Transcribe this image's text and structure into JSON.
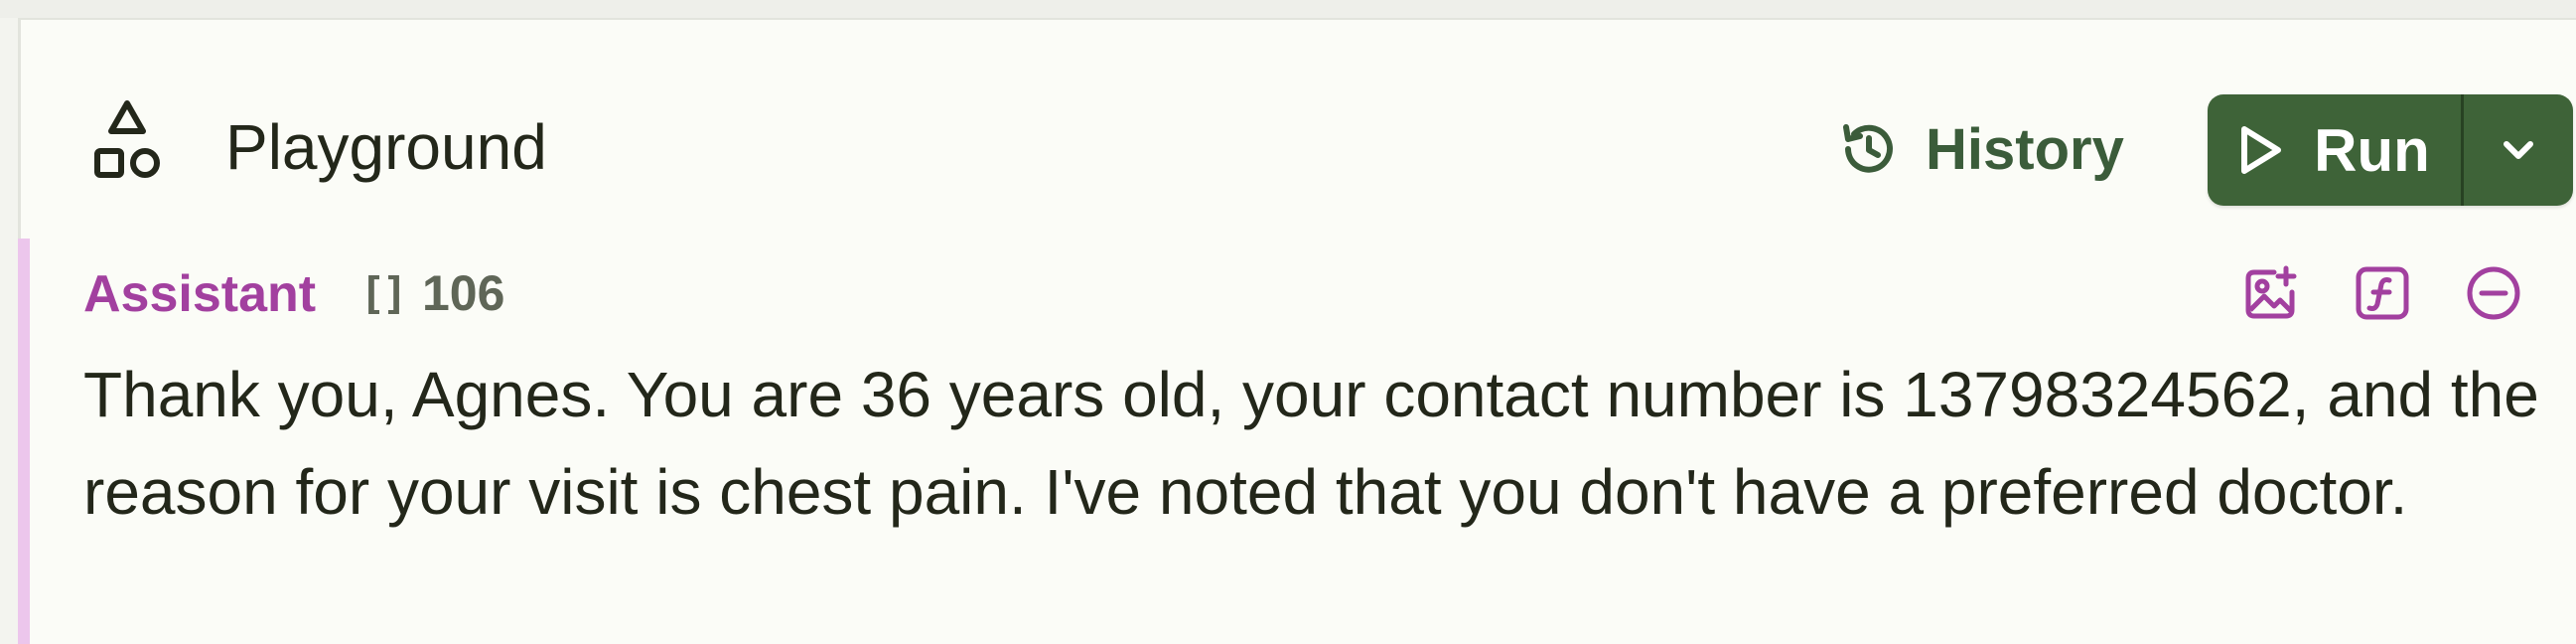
{
  "header": {
    "title": "Playground",
    "title_icon": "shapes-icon",
    "history_label": "History",
    "history_icon": "history-icon",
    "run_label": "Run",
    "run_icon": "play-icon",
    "dropdown_icon": "chevron-down-icon"
  },
  "message": {
    "role": "Assistant",
    "token_icon": "brackets-icon",
    "token_brackets": "[]",
    "token_count": "106",
    "actions": [
      "add-image-icon",
      "function-icon",
      "remove-icon"
    ],
    "text": "Thank you, Agnes. You are 36 years old, your contact number is 13798324562, and the reason for your visit is chest pain. I've noted that you don't have a preferred doctor."
  },
  "colors": {
    "background": "#fbfcf7",
    "run_button": "#3e6338",
    "history_text": "#3b5c3a",
    "assistant_accent": "#a2409f",
    "message_border": "#ecc6ec"
  }
}
